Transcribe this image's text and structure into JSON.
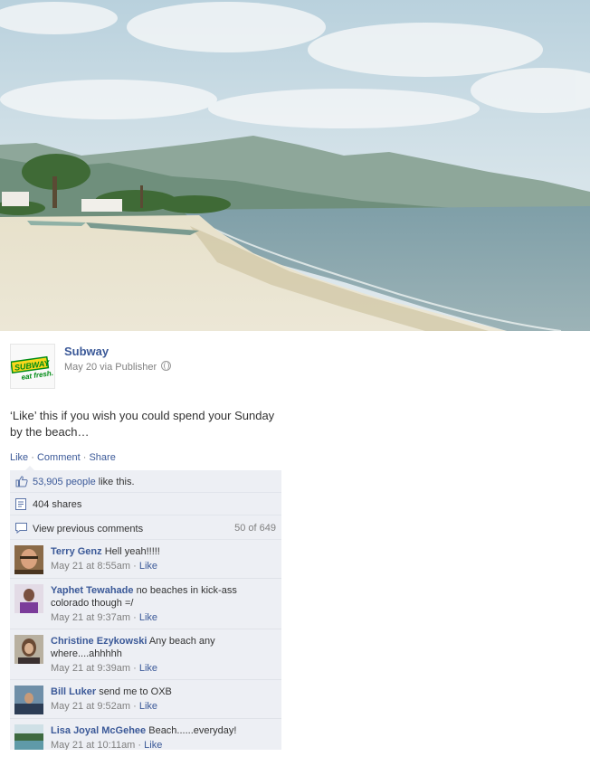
{
  "post": {
    "page_name": "Subway",
    "logo_text": "SUBWAY eat fresh",
    "date": "May 20",
    "via": "via Publisher",
    "text": "‘Like’ this if you wish you could spend your Sunday by the beach…"
  },
  "actions": {
    "like": "Like",
    "comment": "Comment",
    "share": "Share",
    "sep": "·"
  },
  "ufi": {
    "likes_count": "53,905 people",
    "likes_suffix": " like this.",
    "shares": "404 shares",
    "view_previous": "View previous comments",
    "pager": "50 of 649"
  },
  "comments": [
    {
      "name": "Terry Genz",
      "text": "Hell yeah!!!!!",
      "time": "May 21 at 8:55am",
      "like": "Like"
    },
    {
      "name": "Yaphet Tewahade",
      "text": "no beaches in kick-ass colorado though =/",
      "time": "May 21 at 9:37am",
      "like": "Like"
    },
    {
      "name": "Christine Ezykowski",
      "text": "Any beach any where....ahhhhh",
      "time": "May 21 at 9:39am",
      "like": "Like"
    },
    {
      "name": "Bill Luker",
      "text": "send me to OXB",
      "time": "May 21 at 9:52am",
      "like": "Like"
    },
    {
      "name": "Lisa Joyal McGehee",
      "text": "Beach......everyday!",
      "time": "May 21 at 10:11am",
      "like": "Like"
    }
  ],
  "colors": {
    "link": "#3b5998",
    "ufi_bg": "#edeff4",
    "subway_green": "#008c15",
    "subway_yellow": "#f9d71c"
  }
}
